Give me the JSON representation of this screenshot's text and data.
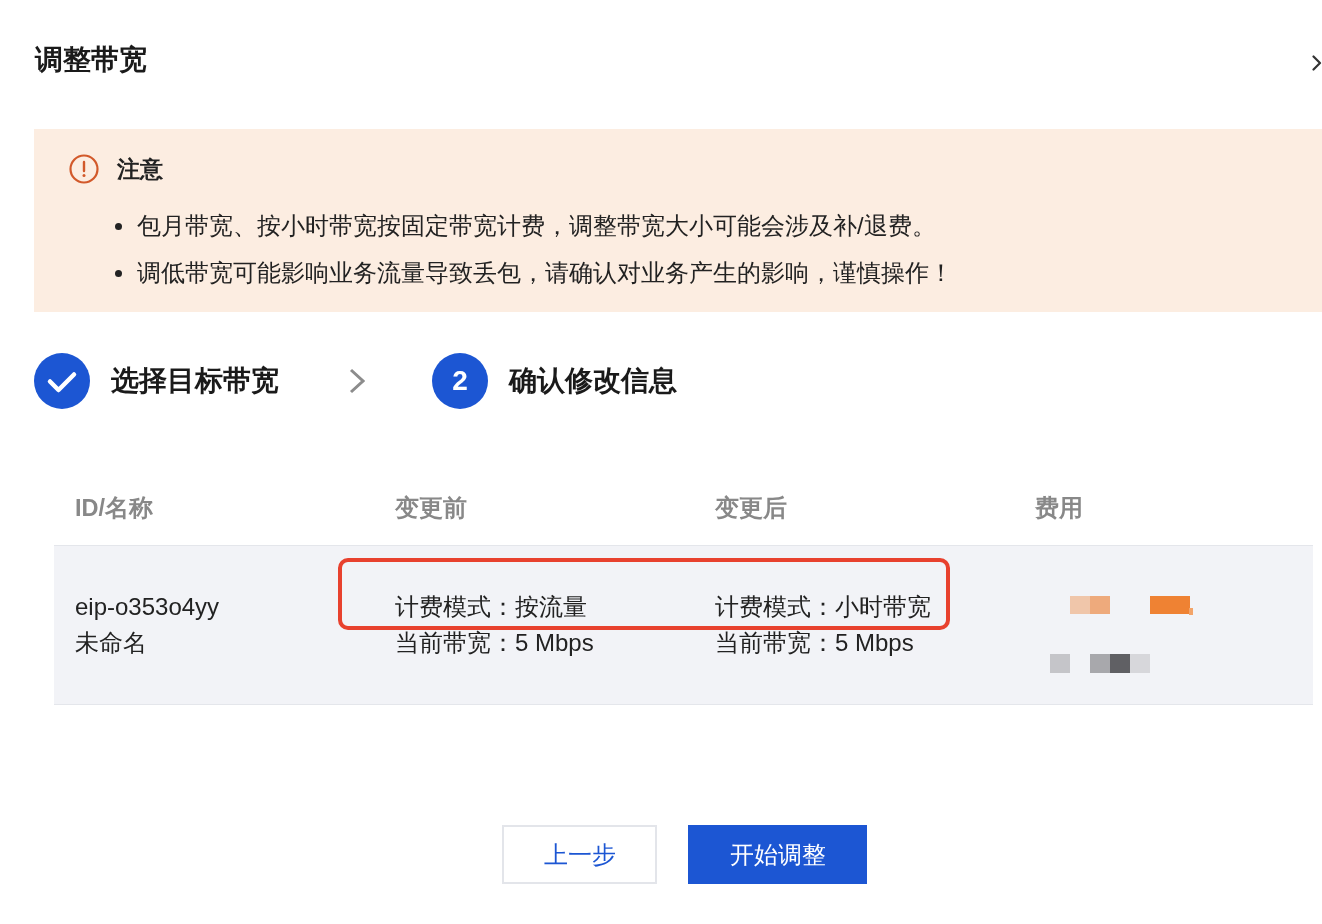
{
  "dialog": {
    "title": "调整带宽"
  },
  "notice": {
    "title": "注意",
    "items": [
      "包月带宽、按小时带宽按固定带宽计费，调整带宽大小可能会涉及补/退费。",
      "调低带宽可能影响业务流量导致丢包，请确认对业务产生的影响，谨慎操作！"
    ]
  },
  "steps": [
    {
      "label": "选择目标带宽",
      "done": true
    },
    {
      "number": "2",
      "label": "确认修改信息",
      "done": false
    }
  ],
  "table": {
    "columns": [
      "ID/名称",
      "变更前",
      "变更后",
      "费用"
    ],
    "rows": [
      {
        "id": "eip-o353o4yy",
        "name": "未命名",
        "changes": [
          {
            "before": "计费模式：按流量",
            "after": "计费模式：小时带宽",
            "highlighted": true
          },
          {
            "before": "当前带宽：5 Mbps",
            "after": "当前带宽：5 Mbps",
            "highlighted": false
          }
        ],
        "fee_redacted": true
      }
    ]
  },
  "buttons": [
    {
      "label": "上一步",
      "kind": "secondary"
    },
    {
      "label": "开始调整",
      "kind": "primary"
    }
  ]
}
